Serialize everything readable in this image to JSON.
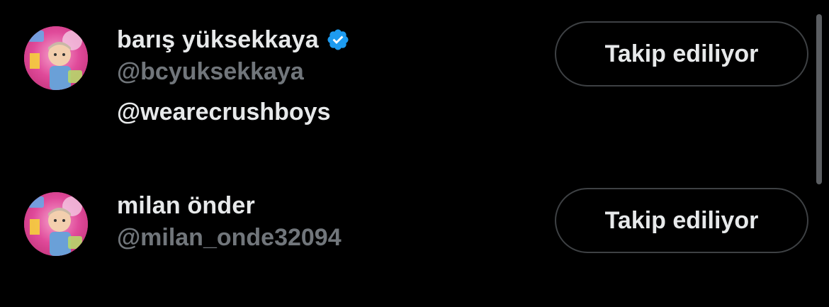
{
  "accounts": [
    {
      "name": "barış yüksekkaya",
      "verified": true,
      "handle": "@bcyuksekkaya",
      "bio": "@wearecrushboys",
      "button_label": "Takip ediliyor"
    },
    {
      "name": "milan önder",
      "verified": false,
      "handle": "@milan_onde32094",
      "bio": "",
      "button_label": "Takip ediliyor"
    }
  ],
  "colors": {
    "background": "#000000",
    "primary_text": "#e7e9ea",
    "secondary_text": "#71767b",
    "verified_badge": "#1d9bf0",
    "button_border": "#3e4144"
  }
}
